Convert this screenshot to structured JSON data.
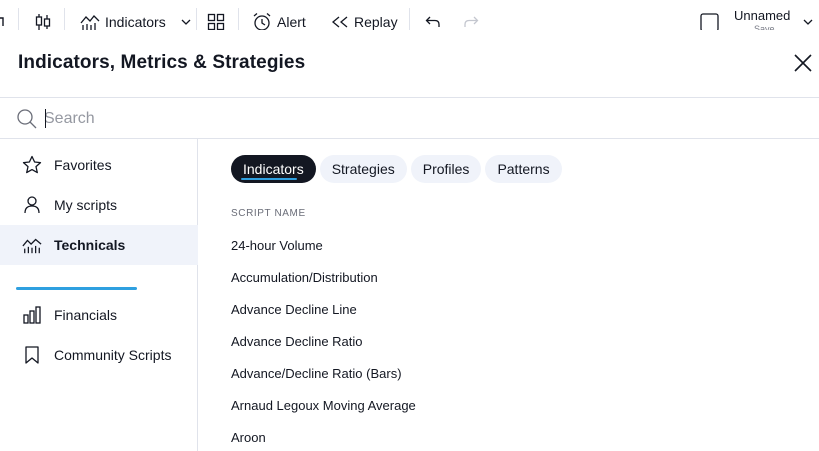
{
  "toolbar": {
    "indicators_label": "Indicators",
    "alert_label": "Alert",
    "replay_label": "Replay",
    "layout_name": "Unnamed",
    "layout_sub": "Save",
    "icons": [
      "candles-icon",
      "indicators-icon",
      "chevron-down-icon",
      "layouts-icon",
      "alert-icon",
      "replay-icon",
      "undo-icon",
      "redo-icon"
    ]
  },
  "dialog": {
    "title": "Indicators, Metrics & Strategies",
    "search_placeholder": "Search"
  },
  "sidebar": {
    "items": [
      {
        "label": "Favorites",
        "icon": "star-icon"
      },
      {
        "label": "My scripts",
        "icon": "user-icon"
      },
      {
        "label": "Technicals",
        "icon": "technicals-icon"
      },
      {
        "label": "Financials",
        "icon": "financials-icon"
      },
      {
        "label": "Community Scripts",
        "icon": "bookmark-icon"
      }
    ],
    "active": "Technicals"
  },
  "tabs": [
    {
      "label": "Indicators"
    },
    {
      "label": "Strategies"
    },
    {
      "label": "Profiles"
    },
    {
      "label": "Patterns"
    }
  ],
  "list": {
    "column_header": "SCRIPT NAME",
    "items": [
      "24-hour Volume",
      "Accumulation/Distribution",
      "Advance Decline Line",
      "Advance Decline Ratio",
      "Advance/Decline Ratio (Bars)",
      "Arnaud Legoux Moving Average",
      "Aroon"
    ]
  },
  "colors": {
    "accent": "#2fa0e0",
    "text": "#131722",
    "active_tab_bg": "#131722",
    "pill_bg": "#f0f3fa",
    "border": "#e0e3eb"
  }
}
